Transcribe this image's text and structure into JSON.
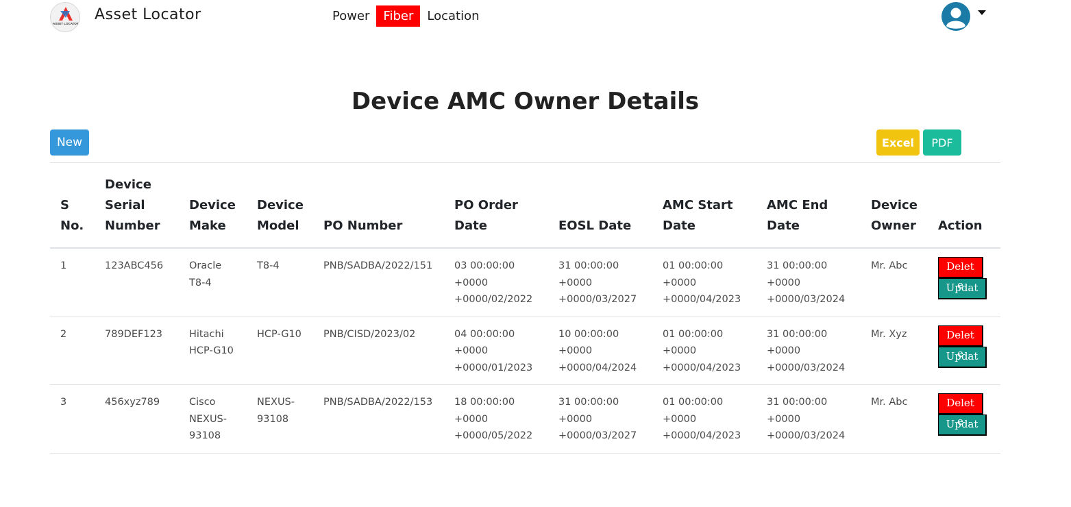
{
  "header": {
    "brand": "Asset Locator",
    "logo_text": "ASSET LOCATOR",
    "nav": [
      {
        "label": "Power",
        "active": false
      },
      {
        "label": "Fiber",
        "active": true
      },
      {
        "label": "Location",
        "active": false
      }
    ],
    "active_color": "#ff0000"
  },
  "page": {
    "title": "Device AMC Owner Details"
  },
  "toolbar": {
    "new_label": "New",
    "excel_label": "Excel",
    "pdf_label": "PDF"
  },
  "table": {
    "columns": [
      "S No.",
      "Device Serial Number",
      "Device Make",
      "Device Model",
      "PO Number",
      "PO Order Date",
      "EOSL Date",
      "AMC Start Date",
      "AMC End Date",
      "Device Owner",
      "Action"
    ],
    "rows": [
      {
        "sno": "1",
        "serial": "123ABC456",
        "make": "Oracle T8-4",
        "model": "T8-4",
        "po_number": "PNB/SADBA/2022/151",
        "po_date": "03 00:00:00 +0000 +0000/02/2022",
        "eosl_date": "31 00:00:00 +0000 +0000/03/2027",
        "amc_start": "01 00:00:00 +0000 +0000/04/2023",
        "amc_end": "31 00:00:00 +0000 +0000/03/2024",
        "owner": "Mr. Abc",
        "delete_label": "Delete",
        "update_label": "Update"
      },
      {
        "sno": "2",
        "serial": "789DEF123",
        "make": "Hitachi HCP-G10",
        "model": "HCP-G10",
        "po_number": "PNB/CISD/2023/02",
        "po_date": "04 00:00:00 +0000 +0000/01/2023",
        "eosl_date": "10 00:00:00 +0000 +0000/04/2024",
        "amc_start": "01 00:00:00 +0000 +0000/04/2023",
        "amc_end": "31 00:00:00 +0000 +0000/03/2024",
        "owner": "Mr. Xyz",
        "delete_label": "Delete",
        "update_label": "Update"
      },
      {
        "sno": "3",
        "serial": "456xyz789",
        "make": "Cisco NEXUS-93108",
        "model": "NEXUS-93108",
        "po_number": "PNB/SADBA/2022/153",
        "po_date": "18 00:00:00 +0000 +0000/05/2022",
        "eosl_date": "31 00:00:00 +0000 +0000/03/2027",
        "amc_start": "01 00:00:00 +0000 +0000/04/2023",
        "amc_end": "31 00:00:00 +0000 +0000/03/2024",
        "owner": "Mr. Abc",
        "delete_label": "Delete",
        "update_label": "Update"
      }
    ]
  },
  "icons": {
    "logo": "asset-locator-logo",
    "avatar": "user-avatar-icon",
    "caret": "caret-down-icon"
  },
  "colors": {
    "new_button": "#3498db",
    "excel_button": "#f1c40f",
    "pdf_button": "#1abc9c",
    "delete_button": "#ff0000",
    "update_button": "#17968a",
    "avatar": "#1c7aa6"
  }
}
